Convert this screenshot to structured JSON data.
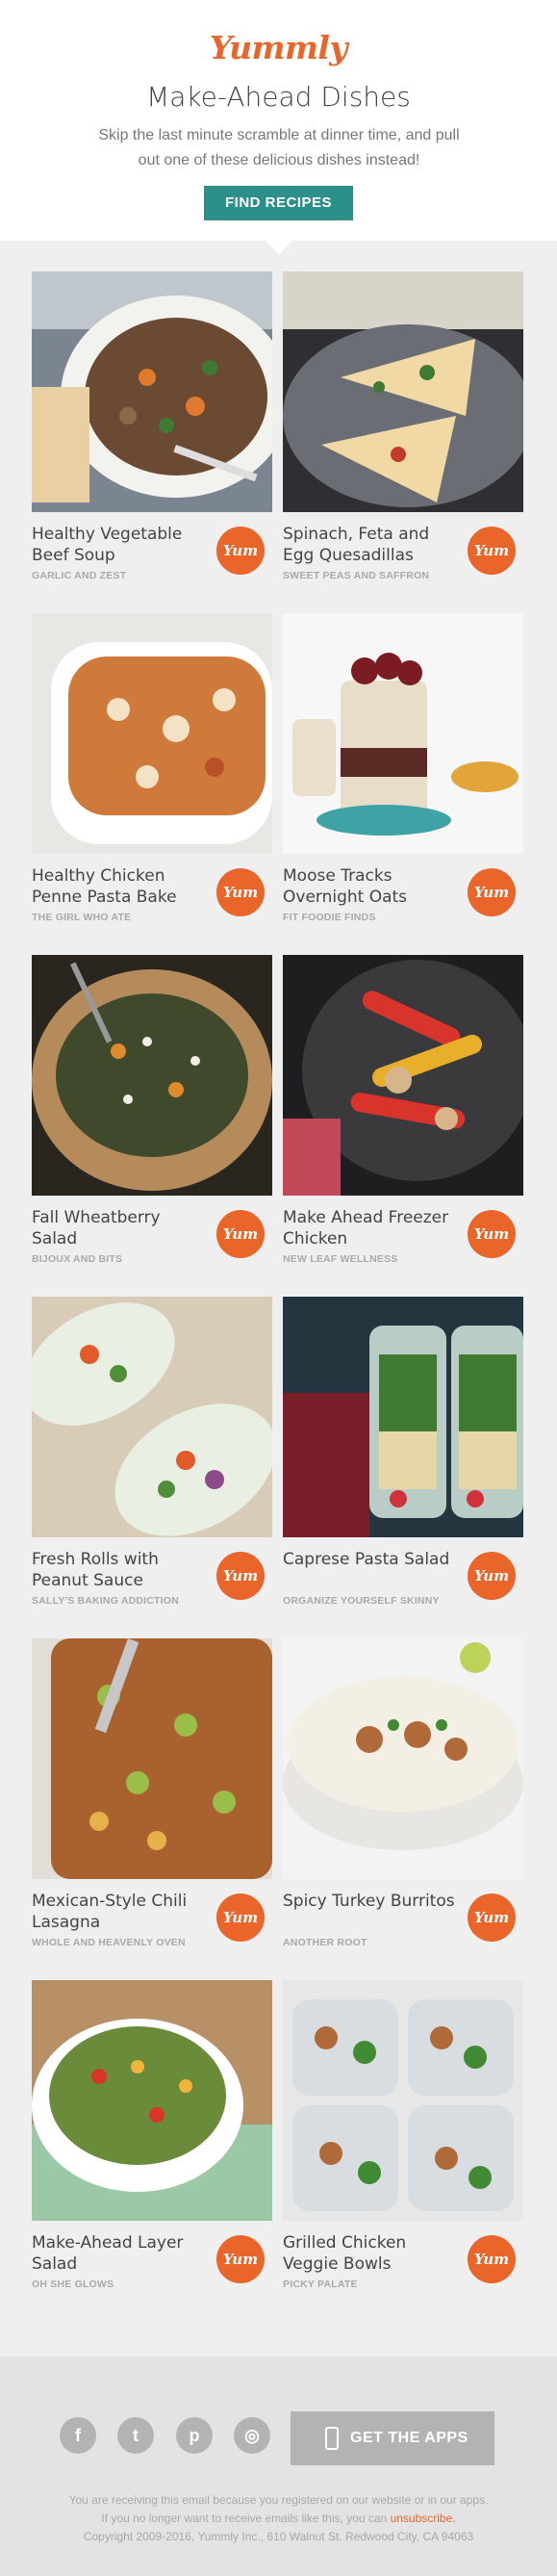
{
  "header": {
    "logo": "Yummly",
    "title": "Make-Ahead Dishes",
    "subtitle": "Skip the last minute scramble at dinner time, and pull out one of these delicious dishes instead!",
    "cta": "FIND RECIPES"
  },
  "yum_label": "Yum",
  "recipes": [
    {
      "title": "Healthy Vegetable Beef Soup",
      "source": "GARLIC AND ZEST"
    },
    {
      "title": "Spinach, Feta and Egg Quesadillas",
      "source": "SWEET PEAS AND SAFFRON"
    },
    {
      "title": "Healthy Chicken Penne Pasta Bake",
      "source": "THE GIRL WHO ATE"
    },
    {
      "title": "Moose Tracks Overnight Oats",
      "source": "FIT FOODIE FINDS"
    },
    {
      "title": "Fall Wheatberry Salad",
      "source": "BIJOUX AND BITS"
    },
    {
      "title": "Make Ahead Freezer Chicken",
      "source": "NEW LEAF WELLNESS"
    },
    {
      "title": "Fresh Rolls with Peanut Sauce",
      "source": "SALLY'S BAKING ADDICTION"
    },
    {
      "title": "Caprese Pasta Salad",
      "source": "ORGANIZE YOURSELF SKINNY"
    },
    {
      "title": "Mexican-Style Chili Lasagna",
      "source": "WHOLE AND HEAVENLY OVEN"
    },
    {
      "title": "Spicy Turkey Burritos",
      "source": "ANOTHER ROOT"
    },
    {
      "title": "Make-Ahead Layer Salad",
      "source": "OH SHE GLOWS"
    },
    {
      "title": "Grilled Chicken Veggie Bowls",
      "source": "PICKY PALATE"
    }
  ],
  "footer": {
    "social": [
      {
        "icon": "facebook-icon",
        "glyph": "f"
      },
      {
        "icon": "twitter-icon",
        "glyph": "t"
      },
      {
        "icon": "pinterest-icon",
        "glyph": "p"
      },
      {
        "icon": "instagram-icon",
        "glyph": "◎"
      }
    ],
    "get_apps": "GET THE APPS",
    "legal_line1": "You are receiving this email because you registered on our website or in our apps.",
    "legal_line2_prefix": "If you no longer want to receive emails like this, you can",
    "unsubscribe": "unsubscribe.",
    "copyright": "Copyright 2009-2016, Yummly Inc., 610 Walnut St. Redwood City, CA 94063"
  },
  "colors": {
    "brand": "#e9652a",
    "cta": "#2c8f89",
    "footer_button": "#b3b3b3"
  }
}
